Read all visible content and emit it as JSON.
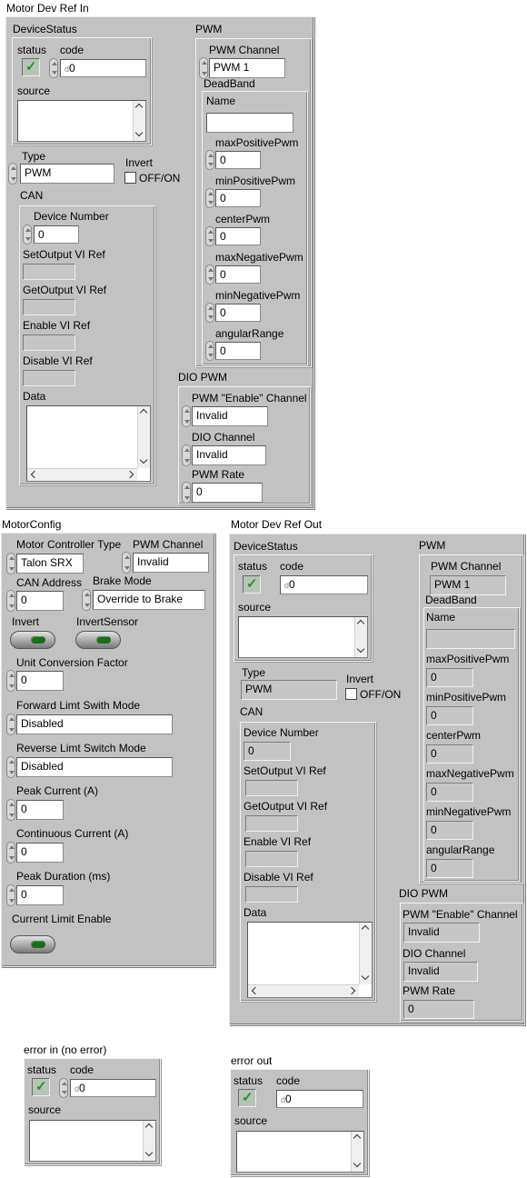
{
  "in": {
    "title": "Motor Dev Ref In",
    "device_status": "DeviceStatus",
    "status": "status",
    "code": "code",
    "code_value": "0",
    "source": "source",
    "type_label": "Type",
    "type_value": "PWM",
    "invert_label": "Invert",
    "offon": "OFF/ON",
    "can": "CAN",
    "device_number": "Device Number",
    "device_number_value": "0",
    "setoutput": "SetOutput VI Ref",
    "getoutput": "GetOutput VI Ref",
    "enable_ref": "Enable VI Ref",
    "disable_ref": "Disable VI Ref",
    "data": "Data",
    "pwm": "PWM",
    "pwm_channel": "PWM Channel",
    "pwm_channel_value": "PWM 1",
    "deadband": "DeadBand",
    "name": "Name",
    "max_pos": "maxPositivePwm",
    "min_pos": "minPositivePwm",
    "center": "centerPwm",
    "max_neg": "maxNegativePwm",
    "min_neg": "minNegativePwm",
    "angular": "angularRange",
    "zero": "0",
    "dio_pwm": "DIO PWM",
    "enable_channel": "PWM \"Enable\" Channel",
    "invalid": "Invalid",
    "dio_channel": "DIO Channel",
    "pwm_rate": "PWM Rate"
  },
  "config": {
    "title": "MotorConfig",
    "controller_type": "Motor Controller Type",
    "controller_type_value": "Talon SRX",
    "pwm_channel": "PWM Channel",
    "pwm_channel_value": "Invalid",
    "can_address": "CAN Address",
    "can_address_value": "0",
    "brake_mode": "Brake Mode",
    "brake_mode_value": "Override to Brake",
    "invert": "Invert",
    "invert_sensor": "InvertSensor",
    "unit_factor": "Unit Conversion Factor",
    "unit_factor_value": "0",
    "fwd_limit": "Forward Limt Swith Mode",
    "fwd_limit_value": "Disabled",
    "rev_limit": "Reverse Limt Switch Mode",
    "rev_limit_value": "Disabled",
    "peak_current": "Peak Current (A)",
    "peak_current_value": "0",
    "cont_current": "Continuous Current (A)",
    "cont_current_value": "0",
    "peak_duration": "Peak Duration (ms)",
    "peak_duration_value": "0",
    "current_limit": "Current Limit Enable"
  },
  "out": {
    "title": "Motor Dev Ref Out",
    "device_status": "DeviceStatus",
    "status": "status",
    "code": "code",
    "code_value": "0",
    "source": "source",
    "type_label": "Type",
    "type_value": "PWM",
    "invert_label": "Invert",
    "offon": "OFF/ON",
    "can": "CAN",
    "device_number": "Device Number",
    "device_number_value": "0",
    "setoutput": "SetOutput VI Ref",
    "getoutput": "GetOutput VI Ref",
    "enable_ref": "Enable VI Ref",
    "disable_ref": "Disable VI Ref",
    "data": "Data",
    "pwm": "PWM",
    "pwm_channel": "PWM Channel",
    "pwm_channel_value": "PWM 1",
    "deadband": "DeadBand",
    "name": "Name",
    "max_pos": "maxPositivePwm",
    "min_pos": "minPositivePwm",
    "center": "centerPwm",
    "max_neg": "maxNegativePwm",
    "min_neg": "minNegativePwm",
    "angular": "angularRange",
    "zero": "0",
    "dio_pwm": "DIO PWM",
    "enable_channel": "PWM \"Enable\" Channel",
    "invalid": "Invalid",
    "dio_channel": "DIO Channel",
    "pwm_rate": "PWM Rate"
  },
  "error_in": {
    "title": "error in (no error)",
    "status": "status",
    "code": "code",
    "code_value": "0",
    "source": "source"
  },
  "error_out": {
    "title": "error out",
    "status": "status",
    "code": "code",
    "code_value": "0",
    "source": "source"
  },
  "icons": {
    "status_ok": "check-mark",
    "status_glyph": "✓",
    "numeric_prefix": "d"
  }
}
